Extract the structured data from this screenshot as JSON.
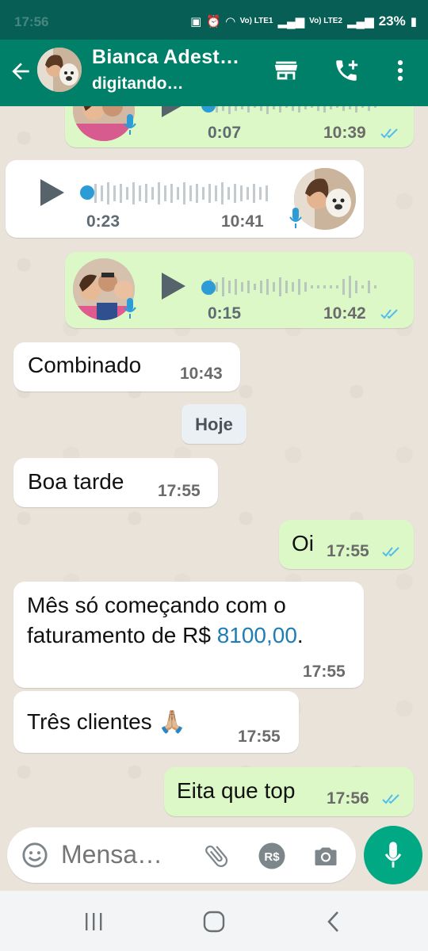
{
  "status": {
    "time": "17:56",
    "net1": "Vo) LTE1",
    "net2": "Vo) LTE2",
    "battery": "23%"
  },
  "header": {
    "contact_name": "Bianca Adest…",
    "contact_status": "digitando…"
  },
  "voice_messages": [
    {
      "direction": "out",
      "duration": "0:07",
      "time": "10:39",
      "read": true
    },
    {
      "direction": "in",
      "duration": "0:23",
      "time": "10:41"
    },
    {
      "direction": "out",
      "duration": "0:15",
      "time": "10:42",
      "read": true
    }
  ],
  "messages": [
    {
      "direction": "in",
      "text": "Combinado",
      "time": "10:43"
    },
    {
      "direction": "in",
      "text": "Boa tarde",
      "time": "17:55"
    },
    {
      "direction": "out",
      "text": "Oi",
      "time": "17:55",
      "read": true
    },
    {
      "direction": "in",
      "line1": "Mês só começando com o",
      "line2_prefix": "faturamento de R$ ",
      "line2_amount": "8100,00",
      "line2_suffix": ".",
      "time": "17:55"
    },
    {
      "direction": "in",
      "text": "Três clientes",
      "emoji": "🙏🏼",
      "time": "17:55"
    },
    {
      "direction": "out",
      "text": "Eita que top",
      "time": "17:56",
      "read": true
    }
  ],
  "day_divider": "Hoje",
  "composer": {
    "placeholder": "Mensa…"
  },
  "colors": {
    "appbar": "#008069",
    "outgoing": "#dcf8c6",
    "incoming": "#ffffff",
    "mic_button": "#00a884",
    "read_ticks": "#53bdeb"
  }
}
